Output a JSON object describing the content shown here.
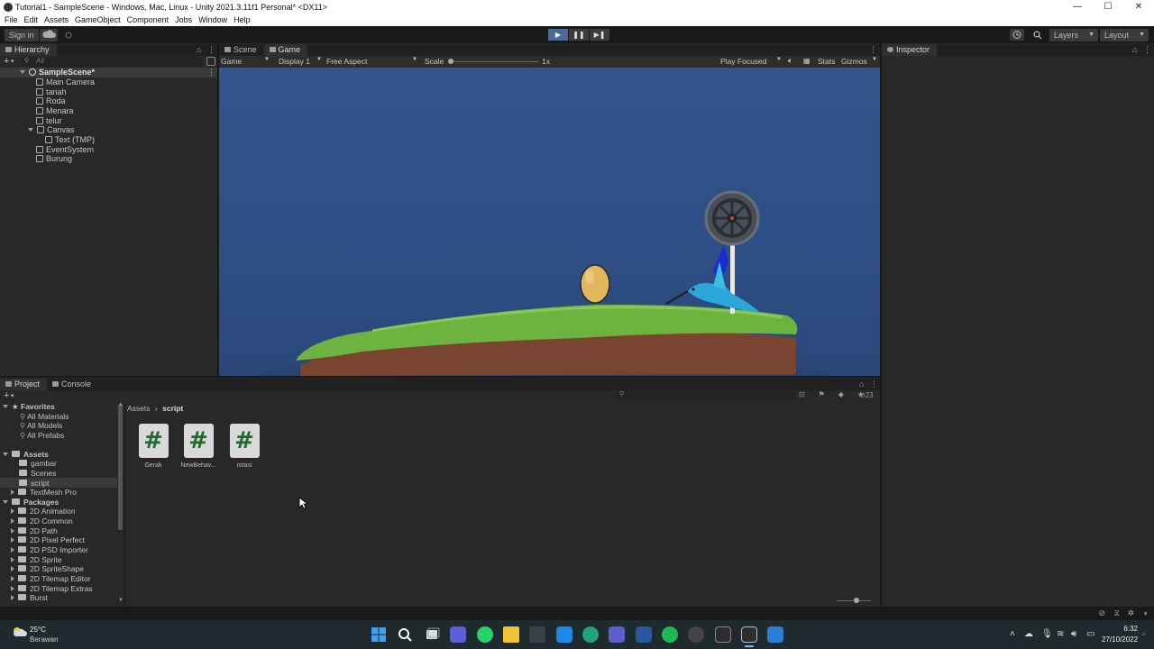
{
  "window": {
    "title": "Tutorial1 - SampleScene - Windows, Mac, Linux - Unity 2021.3.11f1 Personal* <DX11>",
    "controls": [
      "—",
      "☐",
      "✕"
    ]
  },
  "menu": [
    "File",
    "Edit",
    "Assets",
    "GameObject",
    "Component",
    "Jobs",
    "Window",
    "Help"
  ],
  "toolbar": {
    "sign_in": "Sign in",
    "layers": "Layers",
    "layout": "Layout"
  },
  "hierarchy": {
    "tab": "Hierarchy",
    "search_placeholder": "All",
    "scene": "SampleScene*",
    "items": [
      "Main Camera",
      "tanah",
      "Roda",
      "Menara",
      "telur",
      "Canvas",
      "Text (TMP)",
      "EventSystem",
      "Burung"
    ]
  },
  "game_view": {
    "tabs": [
      "Scene",
      "Game"
    ],
    "mode": "Game",
    "display": "Display 1",
    "aspect": "Free Aspect",
    "scale_label": "Scale",
    "scale_value": "1x",
    "play_focused": "Play Focused",
    "stats": "Stats",
    "gizmos": "Gizmos"
  },
  "inspector": {
    "tab": "Inspector"
  },
  "project": {
    "tabs": [
      "Project",
      "Console"
    ],
    "favorites_label": "Favorites",
    "favorites": [
      "All Materials",
      "All Models",
      "All Prefabs"
    ],
    "assets_label": "Assets",
    "assets": [
      "gambar",
      "Scenes",
      "script",
      "TextMesh Pro"
    ],
    "packages_label": "Packages",
    "packages": [
      "2D Animation",
      "2D Common",
      "2D Path",
      "2D Pixel Perfect",
      "2D PSD Importer",
      "2D Sprite",
      "2D SpriteShape",
      "2D Tilemap Editor",
      "2D Tilemap Extras",
      "Burst"
    ],
    "breadcrumb": [
      "Assets",
      "script"
    ],
    "hidden_count": "23",
    "files": [
      "Gerak",
      "NewBehav...",
      "rotasi"
    ],
    "file_glyph": "#"
  },
  "taskbar": {
    "temperature": "25°C",
    "weather": "Berawan",
    "time": "6:32",
    "date": "27/10/2022"
  },
  "colors": {
    "editor_bg": "#282828",
    "sky": "#31558c",
    "grass": "#6db33f",
    "dirt": "#7a4530",
    "play_active": "#4a6a9a"
  }
}
